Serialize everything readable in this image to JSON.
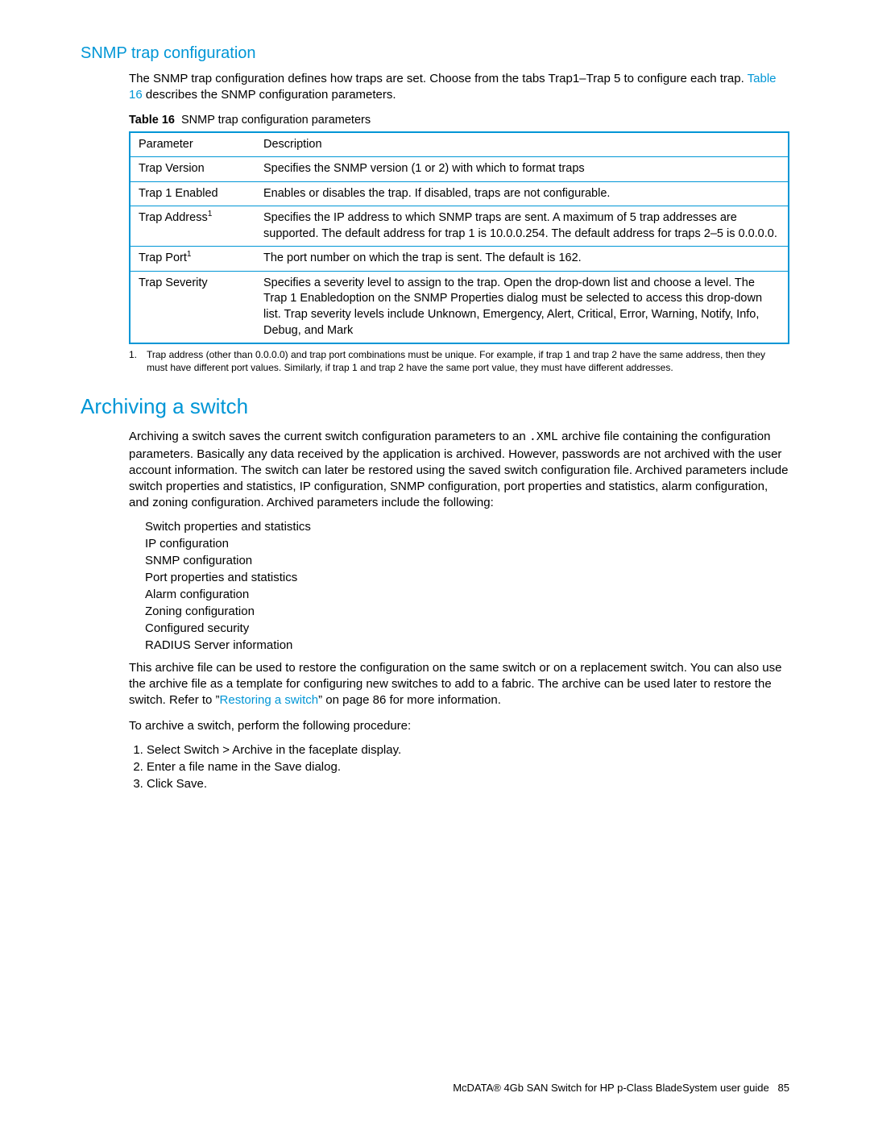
{
  "section1": {
    "heading": "SNMP trap configuration",
    "para_before": "The SNMP trap configuration defines how traps are set. Choose from the tabs Trap1–Trap 5 to configure each trap. ",
    "link": "Table 16",
    "para_after": " describes the SNMP configuration parameters.",
    "caption_label": "Table 16",
    "caption_text": "SNMP trap configuration parameters",
    "head_param": "Parameter",
    "head_desc": "Description",
    "rows": [
      {
        "p": "Trap Version",
        "sup": "",
        "d": "Specifies the SNMP version (1 or 2) with which to format traps"
      },
      {
        "p": "Trap 1 Enabled",
        "sup": "",
        "d": "Enables or disables the trap. If disabled, traps are not configurable."
      },
      {
        "p": "Trap Address",
        "sup": "1",
        "d": "Specifies the IP address to which SNMP traps are sent. A maximum of 5 trap addresses are supported. The default address for trap 1 is 10.0.0.254. The default address for traps 2–5 is 0.0.0.0."
      },
      {
        "p": "Trap Port",
        "sup": "1",
        "d": "The port number on which the trap is sent. The default is 162."
      },
      {
        "p": "Trap Severity",
        "sup": "",
        "d": "Specifies a severity level to assign to the trap. Open the drop-down list and choose a level. The Trap 1 Enabledoption on the SNMP Properties dialog must be selected to access this drop-down list. Trap severity levels include Unknown, Emergency, Alert, Critical, Error, Warning, Notify, Info, Debug, and Mark"
      }
    ],
    "footnote_num": "1.",
    "footnote_text": "Trap address (other than 0.0.0.0) and trap port combinations must be unique. For example, if trap 1 and trap 2 have the same address, then they must have different port values. Similarly, if trap 1 and trap 2 have the same port value, they must have different addresses."
  },
  "section2": {
    "heading": "Archiving a switch",
    "para1_a": "Archiving a switch saves the current switch configuration parameters to an ",
    "para1_code": ".XML",
    "para1_b": " archive file containing the configuration parameters. Basically any data received by the application is archived. However, passwords are not archived with the user account information. The switch can later be restored using the saved switch configuration file. Archived parameters include switch properties and statistics, IP configuration, SNMP configuration, port properties and statistics, alarm configuration, and zoning configuration. Archived parameters include the following:",
    "bullets": [
      "Switch properties and statistics",
      "IP configuration",
      "SNMP configuration",
      "Port properties and statistics",
      "Alarm configuration",
      "Zoning configuration",
      "Configured security",
      "RADIUS Server information"
    ],
    "para2_a": "This archive file can be used to restore the configuration on the same switch or on a replacement switch. You can also use the archive file as a template for configuring new switches to add to a fabric. The archive can be used later to restore the switch. Refer to ”",
    "para2_link": "Restoring a switch",
    "para2_b": "” on page 86 for more information.",
    "para3": "To archive a switch, perform the following procedure:",
    "steps": [
      "Select Switch > Archive in the faceplate display.",
      "Enter a file name in the Save dialog.",
      "Click Save."
    ]
  },
  "footer": {
    "text": "McDATA® 4Gb SAN Switch for HP p-Class BladeSystem user guide",
    "page": "85"
  }
}
